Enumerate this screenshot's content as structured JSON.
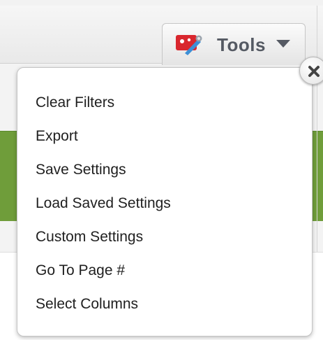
{
  "toolbar": {
    "tools_label": "Tools",
    "tools_icon": "tools-icon",
    "caret_icon": "chevron-down-icon"
  },
  "menu": {
    "items": [
      {
        "label": "Clear Filters"
      },
      {
        "label": "Export"
      },
      {
        "label": "Save Settings"
      },
      {
        "label": "Load Saved Settings"
      },
      {
        "label": "Custom Settings"
      },
      {
        "label": "Go To Page #"
      },
      {
        "label": "Select Columns"
      }
    ],
    "close_icon": "close-icon"
  },
  "colors": {
    "band_green": "#6f9d3a",
    "tools_text": "#555a63",
    "tools_icon_red": "#d9272e",
    "tools_icon_blue": "#3d8fd6"
  }
}
